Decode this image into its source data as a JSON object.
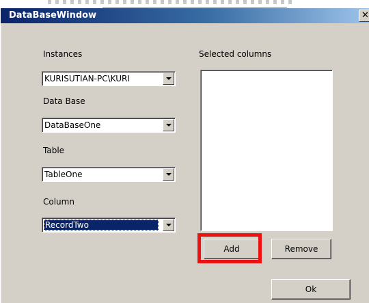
{
  "window": {
    "title": "DataBaseWindow",
    "close_glyph": "✕"
  },
  "form": {
    "instances": {
      "label": "Instances",
      "value": "KURISUTIAN-PC\\KURI"
    },
    "database": {
      "label": "Data Base",
      "value": "DataBaseOne"
    },
    "table": {
      "label": "Table",
      "value": "TableOne"
    },
    "column": {
      "label": "Column",
      "value": "RecordTwo"
    }
  },
  "selected_columns": {
    "label": "Selected columns",
    "items": []
  },
  "buttons": {
    "add": "Add",
    "remove": "Remove",
    "ok": "Ok"
  },
  "colors": {
    "title_gradient_start": "#0a246a",
    "title_gradient_end": "#a6caf0",
    "window_face": "#d4d0c8",
    "selection": "#0a246a",
    "annotation_highlight": "#ee1111"
  }
}
